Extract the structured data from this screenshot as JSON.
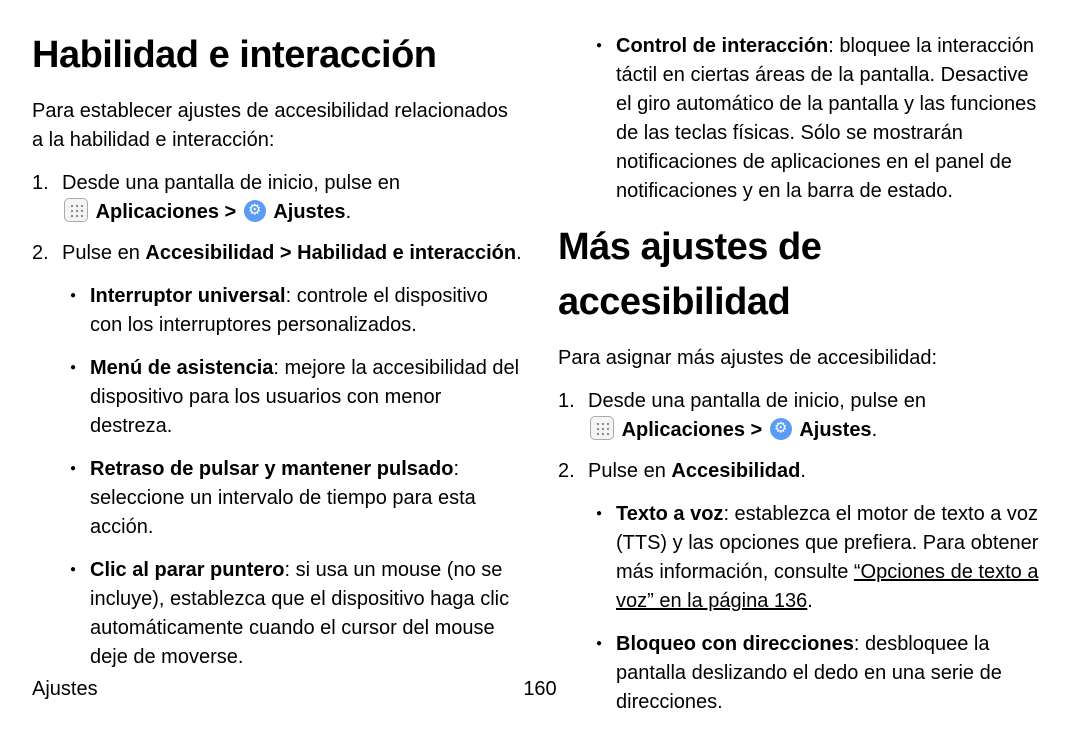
{
  "left": {
    "h1": "Habilidad e interacción",
    "intro": "Para establecer ajustes de accesibilidad relacionados a la habilidad e interacción:",
    "step1": "Desde una pantalla de inicio, pulse en ",
    "apps": "Aplicaciones",
    "sep": " > ",
    "settings": "Ajustes",
    "dot": ".",
    "step2a": "Pulse en ",
    "step2b": "Accesibilidad > Habilidad e interacción",
    "step2c": ".",
    "b1t": "Interruptor universal",
    "b1": ": controle el dispositivo con los interruptores personalizados.",
    "b2t": "Menú de asistencia",
    "b2": ": mejore la accesibilidad del dispositivo para los usuarios con menor destreza.",
    "b3t": "Retraso de pulsar y mantener pulsado",
    "b3": ": seleccione un intervalo de tiempo para esta acción.",
    "b4t": "Clic al parar puntero",
    "b4": ": si usa un mouse (no se incluye), establezca que el dispositivo haga clic automáticamente cuando el cursor del mouse deje de moverse."
  },
  "right": {
    "top_t": "Control de interacción",
    "top": ": bloquee la interacción táctil en ciertas áreas de la pantalla. Desactive el giro automático de la pantalla y las funciones de las teclas físicas. Sólo se mostrarán notificaciones de aplicaciones en el panel de notificaciones y en la barra de estado.",
    "h1": "Más ajustes de accesibilidad",
    "intro": "Para asignar más ajustes de accesibilidad:",
    "step1": "Desde una pantalla de inicio, pulse en ",
    "apps": "Aplicaciones",
    "sep": " > ",
    "settings": "Ajustes",
    "dot": ".",
    "step2a": "Pulse en ",
    "step2b": "Accesibilidad",
    "step2c": ".",
    "b1t": "Texto a voz",
    "b1a": ": establezca el motor de texto a voz (TTS) y las opciones que prefiera. Para obtener más información, consulte ",
    "b1link": "“Opciones de texto a voz” en la página 136",
    "b1end": ".",
    "b2t": "Bloqueo con direcciones",
    "b2": ": desbloquee la pantalla deslizando el dedo en una serie de direcciones."
  },
  "footer": {
    "section": "Ajustes",
    "page": "160"
  }
}
